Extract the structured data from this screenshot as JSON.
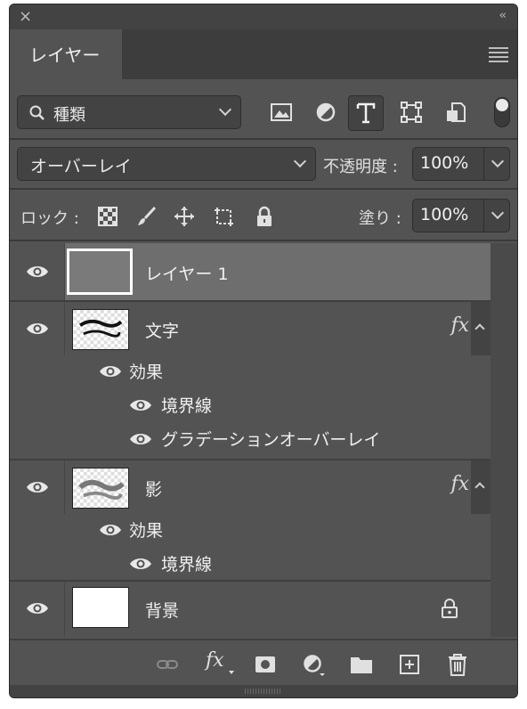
{
  "window": {
    "close_glyph": "×",
    "collapse_glyph": "‹‹"
  },
  "tab": {
    "label": "レイヤー"
  },
  "filter": {
    "kind_label": "種類",
    "icons": [
      "image-filter-icon",
      "adjustment-filter-icon",
      "type-filter-icon",
      "shape-filter-icon",
      "smart-object-filter-icon"
    ],
    "selected_icon": "type-filter-icon"
  },
  "blend": {
    "mode": "オーバーレイ",
    "opacity_label": "不透明度 :",
    "opacity_value": "100%"
  },
  "lock": {
    "label": "ロック :",
    "icons": [
      "lock-transparent-icon",
      "lock-image-icon",
      "lock-position-icon",
      "lock-artboard-icon",
      "lock-all-icon"
    ],
    "fill_label": "塗り :",
    "fill_value": "100%"
  },
  "layers": [
    {
      "name": "レイヤー 1",
      "selected": true
    },
    {
      "name": "文字",
      "fx": "fx",
      "effects_label": "効果",
      "effects": [
        "境界線",
        "グラデーションオーバーレイ"
      ]
    },
    {
      "name": "影",
      "fx": "fx",
      "effects_label": "効果",
      "effects": [
        "境界線"
      ]
    },
    {
      "name": "背景",
      "locked": true
    }
  ],
  "bottom_icons": [
    "link-icon",
    "fx-icon",
    "mask-icon",
    "adjustment-layer-icon",
    "folder-icon",
    "new-layer-icon",
    "trash-icon"
  ],
  "bottom_fx_label": "fx",
  "colors": {
    "panel": "#535353",
    "selected_row": "#6e6e6e",
    "dark": "#434343"
  }
}
